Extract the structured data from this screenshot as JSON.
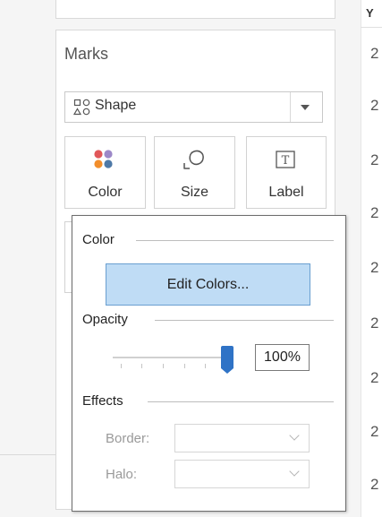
{
  "marks": {
    "title": "Marks",
    "mark_type": {
      "label": "Shape",
      "icon": "shape-icon"
    },
    "buttons": [
      {
        "label": "Color",
        "icon": "color-dots-icon"
      },
      {
        "label": "Size",
        "icon": "size-shape-icon"
      },
      {
        "label": "Label",
        "icon": "label-text-icon"
      }
    ]
  },
  "table": {
    "column_header": "Y",
    "cells": [
      "2",
      "2",
      "2",
      "2",
      "2",
      "2",
      "2",
      "2",
      "2"
    ]
  },
  "color_popup": {
    "color_section": "Color",
    "edit_colors_label": "Edit Colors...",
    "opacity_section": "Opacity",
    "opacity_value": "100%",
    "opacity_fraction": 1.0,
    "effects_section": "Effects",
    "border_label": "Border:",
    "halo_label": "Halo:"
  },
  "colors": {
    "accent": "#2f73c6",
    "button_fill": "#bfdcf5",
    "color_dots": [
      "#e15759",
      "#9c88c8",
      "#f28e2b",
      "#4e79a7"
    ]
  }
}
